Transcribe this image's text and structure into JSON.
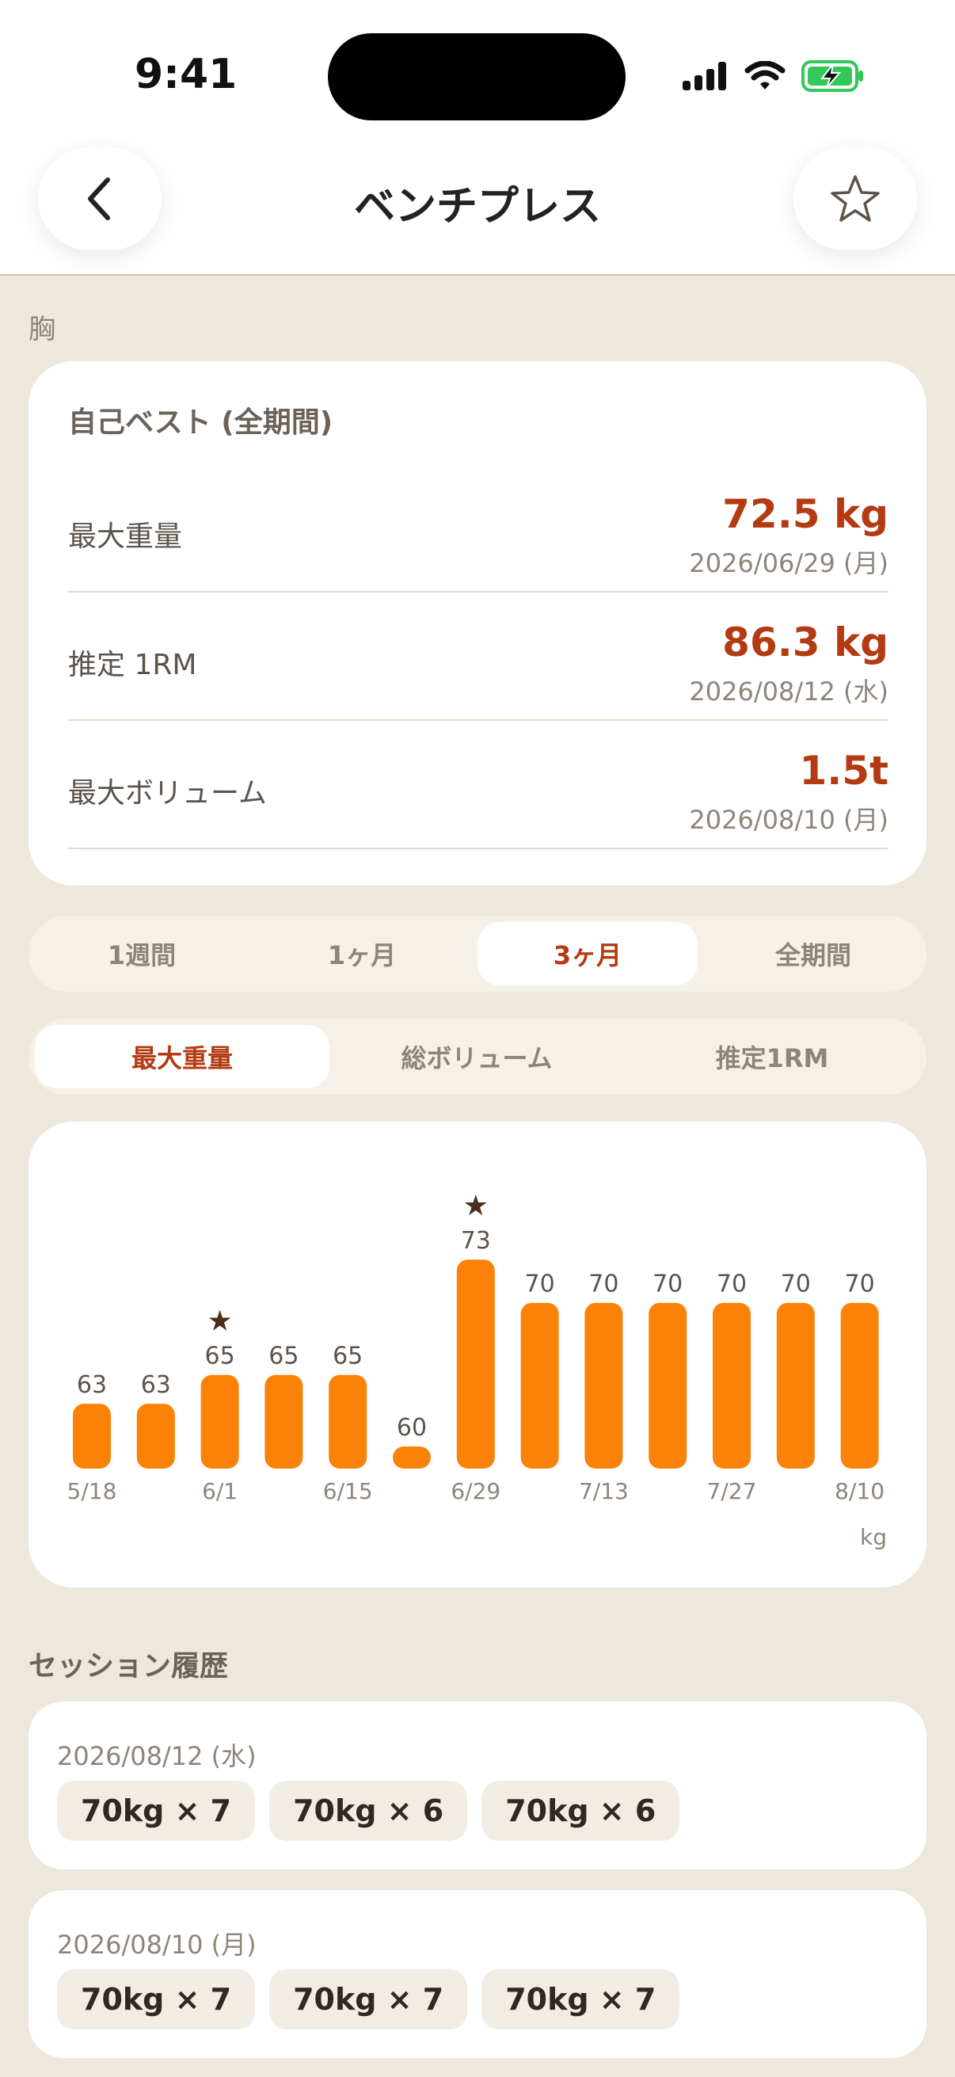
{
  "status_bar": {
    "time": "9:41"
  },
  "header": {
    "title": "ベンチプレス",
    "back_icon": "chevron-left-icon",
    "favorite_icon": "star-outline-icon"
  },
  "category": "胸",
  "personal_best": {
    "title": "自己ベスト (全期間)",
    "rows": [
      {
        "label": "最大重量",
        "value": "72.5 kg",
        "date": "2026/06/29 (月)"
      },
      {
        "label": "推定 1RM",
        "value": "86.3 kg",
        "date": "2026/08/12 (水)"
      },
      {
        "label": "最大ボリューム",
        "value": "1.5t",
        "date": "2026/08/10 (月)"
      }
    ]
  },
  "period_tabs": {
    "items": [
      "1週間",
      "1ヶ月",
      "3ヶ月",
      "全期間"
    ],
    "selected": "3ヶ月"
  },
  "metric_tabs": {
    "items": [
      "最大重量",
      "総ボリューム",
      "推定1RM"
    ],
    "selected": "最大重量"
  },
  "colors": {
    "accent": "#B33A12",
    "bar": "#FB8207",
    "background": "#EEE7DB",
    "star": "#4A2E1C"
  },
  "chart_data": {
    "type": "bar",
    "categories": [
      "5/18",
      "",
      "6/1",
      "",
      "6/15",
      "",
      "6/29",
      "",
      "7/13",
      "",
      "7/27",
      "",
      "8/10"
    ],
    "values": [
      63,
      63,
      65,
      65,
      65,
      60,
      73,
      70,
      70,
      70,
      70,
      70,
      70
    ],
    "starred": [
      false,
      false,
      true,
      false,
      false,
      false,
      true,
      false,
      false,
      false,
      false,
      false,
      false
    ],
    "unit": "kg",
    "grid": false,
    "title": "",
    "xlabel": "",
    "ylabel": ""
  },
  "sessions": {
    "title": "セッション履歴",
    "items": [
      {
        "date": "2026/08/12 (水)",
        "sets": [
          "70kg × 7",
          "70kg × 6",
          "70kg × 6"
        ]
      },
      {
        "date": "2026/08/10 (月)",
        "sets": [
          "70kg × 7",
          "70kg × 7",
          "70kg × 7"
        ]
      }
    ]
  }
}
